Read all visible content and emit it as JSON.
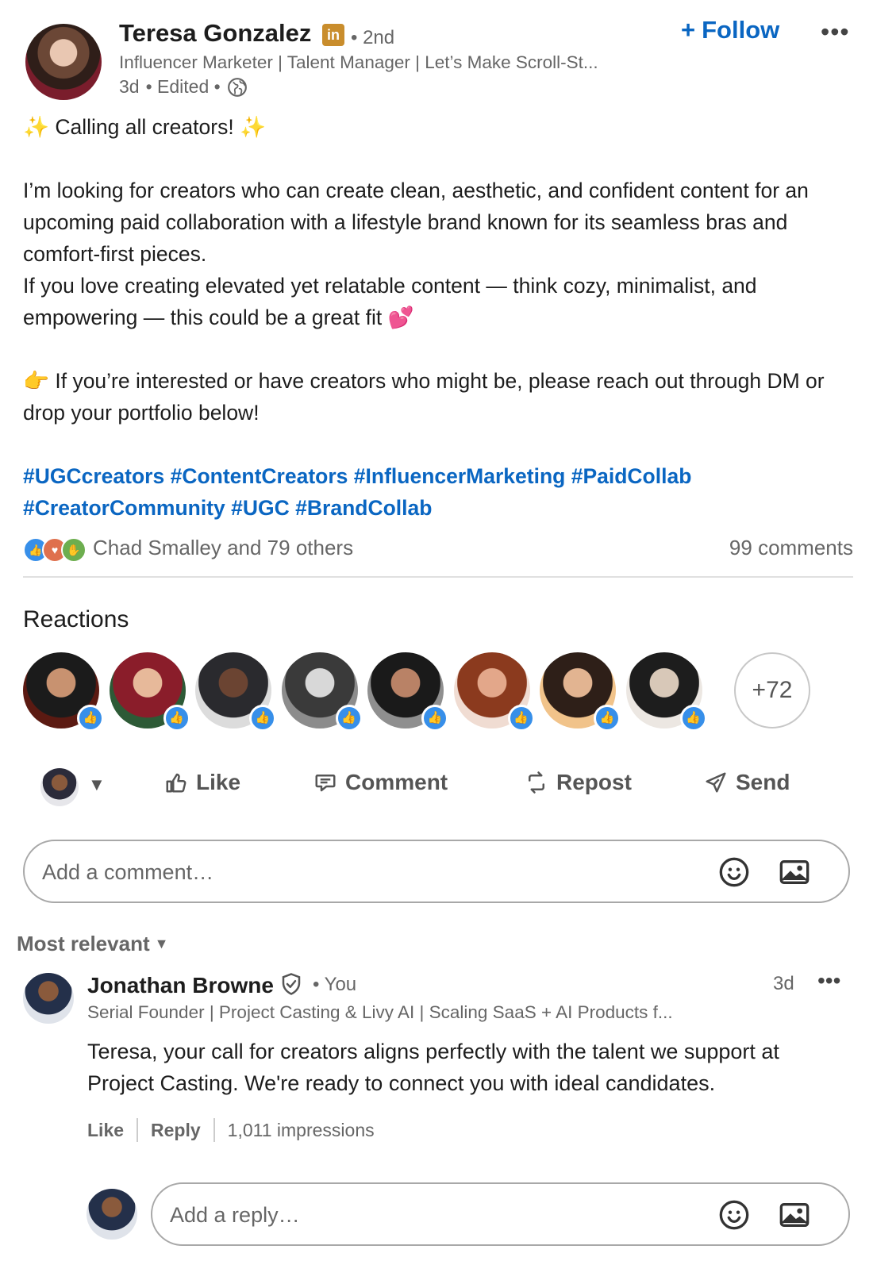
{
  "post": {
    "author_name": "Teresa Gonzalez",
    "badge_text": "in",
    "degree": "• 2nd",
    "headline": "Influencer Marketer | Talent Manager | Let’s Make Scroll-St...",
    "time": "3d",
    "edited": "• Edited •",
    "follow_label": "Follow",
    "body": {
      "line1": "✨ Calling all creators! ✨",
      "para2": "I’m looking for creators who can create clean, aesthetic, and confident content for an upcoming paid collaboration with a lifestyle brand known for its seamless bras and comfort-first pieces.",
      "para3": "If you love creating elevated yet relatable content — think cozy, minimalist, and empowering — this could be a great fit 💕",
      "para4": "👉 If you’re interested or have creators who might be, please reach out through DM or drop your portfolio below!",
      "hashtags": [
        "#UGCcreators",
        "#ContentCreators",
        "#InfluencerMarketing",
        "#PaidCollab",
        "#CreatorCommunity",
        "#UGC",
        "#BrandCollab"
      ]
    },
    "reactors_text": "Chad Smalley and 79 others",
    "comments_count": "99 comments"
  },
  "reactions": {
    "title": "Reactions",
    "more_count": "+72",
    "people": [
      {
        "name": "reactor-1",
        "colors": [
          "#c89270",
          "#1b1b1b",
          "#5b1a12"
        ]
      },
      {
        "name": "reactor-2",
        "colors": [
          "#e7b99a",
          "#8a1d2a",
          "#2d5a36"
        ]
      },
      {
        "name": "reactor-3",
        "colors": [
          "#6b4432",
          "#2a2a2e",
          "#dcdcdc"
        ]
      },
      {
        "name": "reactor-4",
        "colors": [
          "#d8d8d8",
          "#3a3a3a",
          "#8c8c8c"
        ]
      },
      {
        "name": "reactor-5",
        "colors": [
          "#b98266",
          "#1a1a1a",
          "#8f8f8f"
        ]
      },
      {
        "name": "reactor-6",
        "colors": [
          "#e3a78a",
          "#8b3a1e",
          "#f0dcd2"
        ]
      },
      {
        "name": "reactor-7",
        "colors": [
          "#e2b491",
          "#2e1f18",
          "#f1c38a"
        ]
      },
      {
        "name": "reactor-8",
        "colors": [
          "#d8c8b8",
          "#1d1d1d",
          "#ece7e2"
        ]
      }
    ]
  },
  "actions": {
    "like": "Like",
    "comment": "Comment",
    "repost": "Repost",
    "send": "Send"
  },
  "composer": {
    "placeholder": "Add a comment…"
  },
  "sort": {
    "label": "Most relevant"
  },
  "comment": {
    "author": "Jonathan Browne",
    "you": "• You",
    "time": "3d",
    "headline": "Serial Founder | Project Casting & Livy AI | Scaling SaaS + AI Products f...",
    "text": "Teresa, your call for creators aligns perfectly with the talent we support at Project Casting. We're ready to connect you with ideal candidates.",
    "like": "Like",
    "reply": "Reply",
    "impressions": "1,011 impressions"
  },
  "reply_box": {
    "placeholder": "Add a reply…"
  },
  "colors": {
    "link_blue": "#0a66c2",
    "like_blue": "#378fe9",
    "muted_text": "#666666"
  }
}
